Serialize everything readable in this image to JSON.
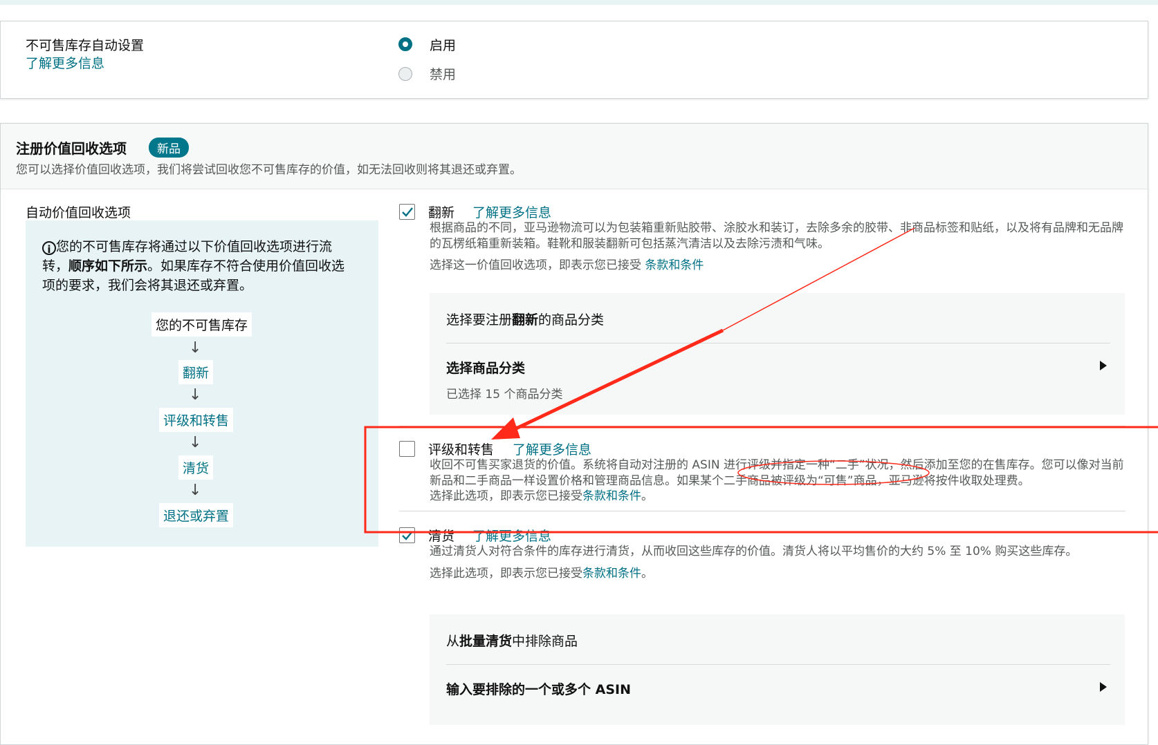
{
  "auto_settings": {
    "title": "不可售库存自动设置",
    "learn_more": "了解更多信息",
    "options": [
      {
        "label": "启用",
        "selected": true
      },
      {
        "label": "禁用",
        "selected": false
      }
    ]
  },
  "recovery": {
    "title": "注册价值回收选项",
    "badge": "新品",
    "subtitle": "您可以选择价值回收选项，我们将尝试回收您不可售库存的价值，如无法回收则将其退还或弃置。",
    "left": {
      "label": "自动价值回收选项",
      "info_pre": "您的不可售库存将通过以下价值回收选项进行流转，",
      "info_bold": "顺序如下所示",
      "info_post": "。如果库存不符合使用价值回收选项的要求，我们会将其退还或弃置。",
      "flow_items": [
        "您的不可售库存",
        "翻新",
        "评级和转售",
        "清货",
        "退还或弃置"
      ]
    },
    "refurbish": {
      "checked": true,
      "title": "翻新",
      "learn_more": "了解更多信息",
      "desc": "根据商品的不同，亚马逊物流可以为包装箱重新贴胶带、涂胶水和装订，去除多余的胶带、非商品标签和贴纸，以及将有品牌和无品牌的瓦楞纸箱重新装箱。鞋靴和服装翻新可包括蒸汽清洁以及去除污渍和气味。",
      "terms_pre": "选择这一价值回收选项，即表示您已接受",
      "terms_link": "条款和条件",
      "panel_title_pre": "选择要注册",
      "panel_title_bold": "翻新",
      "panel_title_post": "的商品分类",
      "select_title": "选择商品分类",
      "selected_text": "已选择 15 个商品分类"
    },
    "grade_resell": {
      "checked": false,
      "title": "评级和转售",
      "learn_more": "了解更多信息",
      "desc": "收回不可售买家退货的价值。系统将自动对注册的 ASIN 进行评级并指定一种“二手”状况，然后添加至您的在售库存。您可以像对当前新品和二手商品一样设置价格和管理商品信息。如果某个二手商品被评级为“可售”商品，亚马逊将按件收取处理费。",
      "terms_pre": "选择此选项，即表示您已接受",
      "terms_link": "条款和条件",
      "terms_post": "。"
    },
    "liquidation": {
      "checked": true,
      "title": "清货",
      "learn_more": "了解更多信息",
      "desc": "通过清货人对符合条件的库存进行清货，从而收回这些库存的价值。清货人将以平均售价的大约 5% 至 10% 购买这些库存。",
      "terms_pre": "选择此选项，即表示您已接受",
      "terms_link": "条款和条件",
      "terms_post": "。",
      "panel_title_pre": "从",
      "panel_title_bold": "批量清货",
      "panel_title_post": "中排除商品",
      "asin_title": "输入要排除的一个或多个 ASIN"
    }
  },
  "colors": {
    "accent": "#007185",
    "annotation": "#ff2a1a"
  }
}
